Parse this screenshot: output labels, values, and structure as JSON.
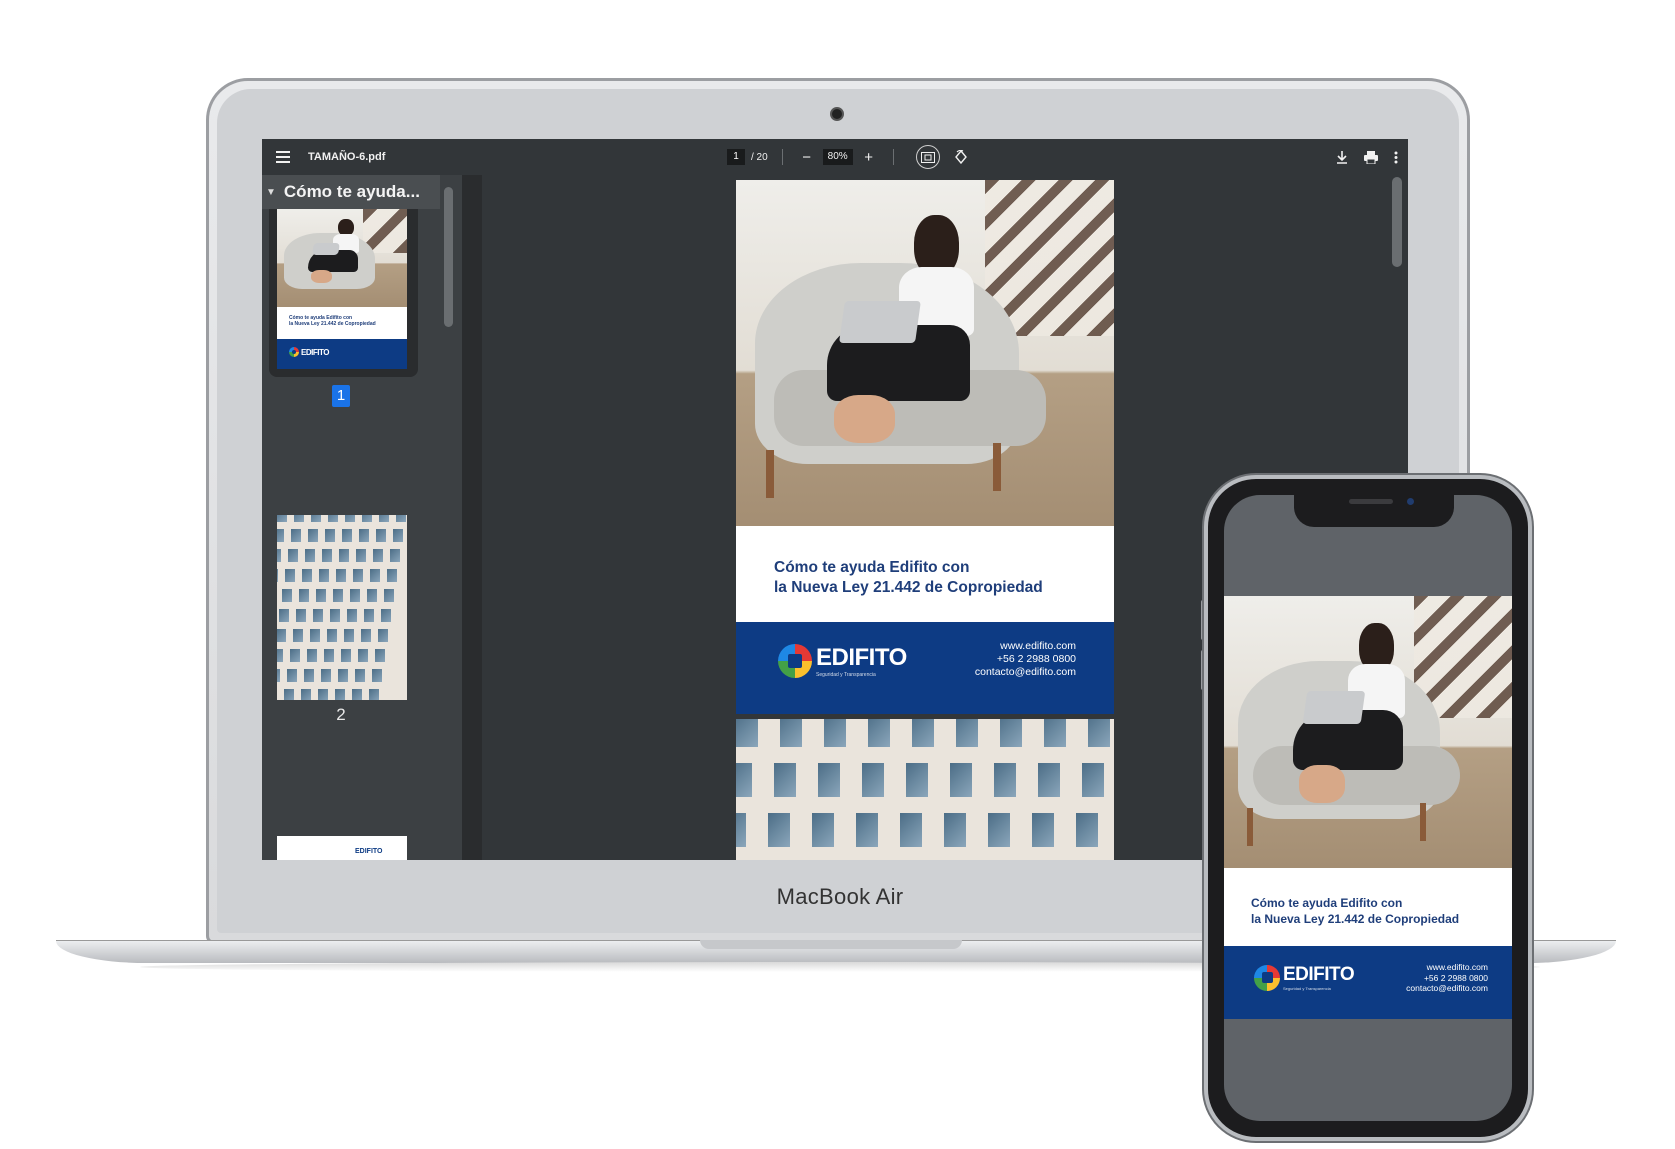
{
  "laptop": {
    "brand": "MacBook Air",
    "viewer": {
      "filename": "TAMAÑO-6.pdf",
      "current_page": "1",
      "total_pages": "/ 20",
      "zoom": "80%",
      "outline_title": "Cómo te ayuda...",
      "thumb_labels": [
        "1",
        "2"
      ],
      "icons": [
        "menu-icon",
        "zoom-out-icon",
        "zoom-in-icon",
        "fit-page-icon",
        "rotate-icon",
        "download-icon",
        "print-icon",
        "more-vert-icon"
      ]
    }
  },
  "flyer": {
    "title_line1": "Cómo te ayuda Edifito con",
    "title_line2": "la Nueva Ley 21.442 de Copropiedad",
    "logo_text": "EDIFITO",
    "tagline": "Seguridad y Transparencia",
    "web": "www.edifito.com",
    "phone": "+56 2 2988 0800",
    "email": "contacto@edifito.com",
    "thumb_title_line1": "Cómo te ayuda Edifito con",
    "thumb_title_line2": "la Nueva Ley 21.442 de Copropiedad",
    "thumb_logo": "EDIFITO",
    "colors": {
      "band": "#0d3b84",
      "title": "#1f3e7a",
      "viewer_bg": "#323639",
      "page_badge": "#1a73e8"
    }
  }
}
